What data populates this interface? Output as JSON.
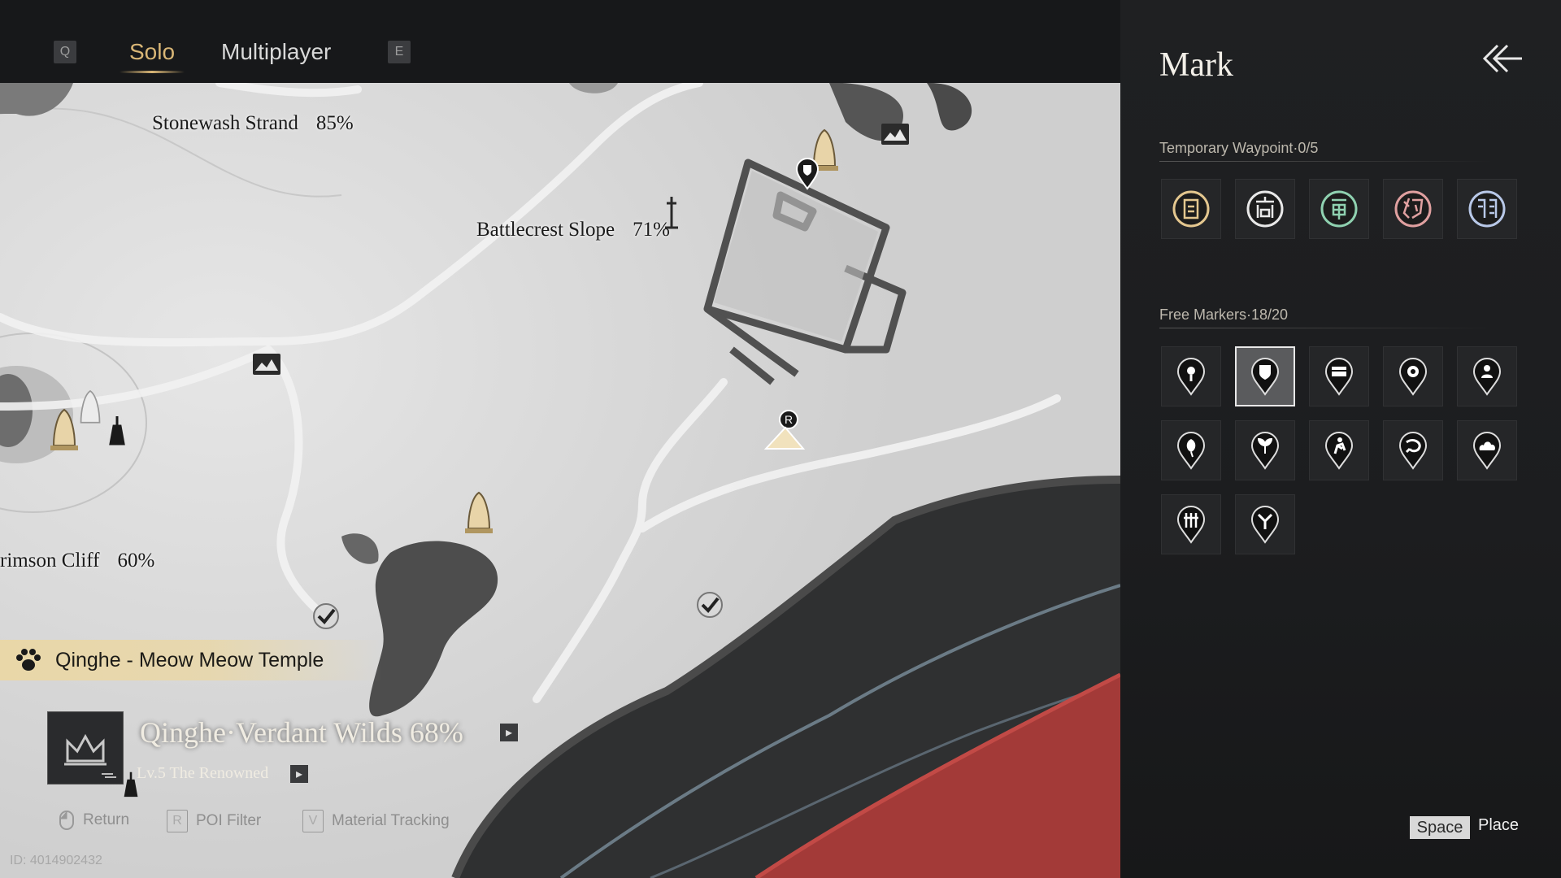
{
  "tabs": {
    "left_key": "Q",
    "solo": "Solo",
    "multiplayer": "Multiplayer",
    "right_key": "E"
  },
  "map": {
    "areas": [
      {
        "name": "Stonewash Strand",
        "pct": "85%"
      },
      {
        "name": "Battlecrest Slope",
        "pct": "71%"
      },
      {
        "name": "rimson Cliff",
        "pct": "60%"
      }
    ],
    "poi_banner": {
      "icon": "paw-icon",
      "text": "Qinghe - Meow Meow Temple"
    },
    "region": {
      "name": "Qinghe·Verdant Wilds 68%",
      "level": "Lv.5 The Renowned"
    },
    "hints": [
      {
        "key": "",
        "icon": "mouse-icon",
        "label": "Return"
      },
      {
        "key": "R",
        "label": "POI Filter"
      },
      {
        "key": "V",
        "label": "Material Tracking"
      }
    ],
    "id_text": "ID: 4014902432"
  },
  "panel": {
    "title": "Mark",
    "temp_waypoint_title": "Temporary Waypoint·0/5",
    "temp_waypoints": [
      {
        "icon": "glyph-gong-icon",
        "color": "#e4c78f"
      },
      {
        "icon": "glyph-shang-icon",
        "color": "#e8e8e8"
      },
      {
        "icon": "glyph-jue-icon",
        "color": "#8fd1b0"
      },
      {
        "icon": "glyph-zhi-icon",
        "color": "#e0a0a0"
      },
      {
        "icon": "glyph-yu-icon",
        "color": "#b8c8e8"
      }
    ],
    "free_markers_title": "Free Markers·18/20",
    "free_markers": [
      {
        "icon": "pin-location-icon",
        "selected": false
      },
      {
        "icon": "shield-pin-icon",
        "selected": true
      },
      {
        "icon": "chest-pin-icon",
        "selected": false
      },
      {
        "icon": "eye-pin-icon",
        "selected": false
      },
      {
        "icon": "person-pin-icon",
        "selected": false
      },
      {
        "icon": "leaf-pin-icon",
        "selected": false
      },
      {
        "icon": "sprout-pin-icon",
        "selected": false
      },
      {
        "icon": "fighter-pin-icon",
        "selected": false
      },
      {
        "icon": "fish-pin-icon",
        "selected": false
      },
      {
        "icon": "cloud-pin-icon",
        "selected": false
      },
      {
        "icon": "crossed-tools-pin-icon",
        "selected": false
      },
      {
        "icon": "fork-pin-icon",
        "selected": false
      }
    ],
    "space_key": "Space",
    "place_label": "Place"
  }
}
